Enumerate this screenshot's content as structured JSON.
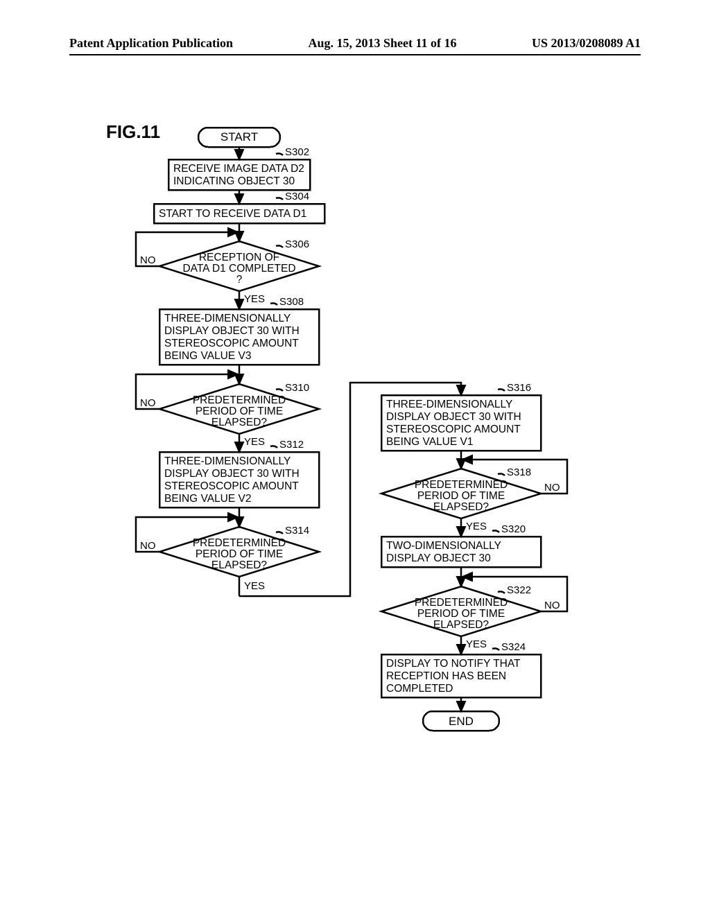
{
  "header": {
    "left": "Patent Application Publication",
    "mid": "Aug. 15, 2013  Sheet 11 of 16",
    "right": "US 2013/0208089 A1"
  },
  "fig_label": "FIG.11",
  "terminators": {
    "start": "START",
    "end": "END"
  },
  "steps": {
    "s302": {
      "ref": "S302",
      "l1": "RECEIVE IMAGE DATA D2",
      "l2": "INDICATING OBJECT 30"
    },
    "s304": {
      "ref": "S304",
      "l1": "START TO RECEIVE DATA D1"
    },
    "s306": {
      "ref": "S306",
      "l1": "RECEPTION OF",
      "l2": "DATA D1 COMPLETED",
      "l3": "?"
    },
    "s308": {
      "ref": "S308",
      "l1": "THREE-DIMENSIONALLY",
      "l2": "DISPLAY OBJECT 30 WITH",
      "l3": "STEREOSCOPIC AMOUNT",
      "l4": "BEING VALUE V3"
    },
    "s310": {
      "ref": "S310",
      "l1": "PREDETERMINED",
      "l2": "PERIOD OF TIME",
      "l3": "ELAPSED?"
    },
    "s312": {
      "ref": "S312",
      "l1": "THREE-DIMENSIONALLY",
      "l2": "DISPLAY OBJECT 30 WITH",
      "l3": "STEREOSCOPIC AMOUNT",
      "l4": "BEING VALUE V2"
    },
    "s314": {
      "ref": "S314",
      "l1": "PREDETERMINED",
      "l2": "PERIOD OF TIME",
      "l3": "ELAPSED?"
    },
    "s316": {
      "ref": "S316",
      "l1": "THREE-DIMENSIONALLY",
      "l2": "DISPLAY OBJECT 30 WITH",
      "l3": "STEREOSCOPIC AMOUNT",
      "l4": "BEING VALUE V1"
    },
    "s318": {
      "ref": "S318",
      "l1": "PREDETERMINED",
      "l2": "PERIOD OF TIME",
      "l3": "ELAPSED?"
    },
    "s320": {
      "ref": "S320",
      "l1": "TWO-DIMENSIONALLY",
      "l2": "DISPLAY OBJECT 30"
    },
    "s322": {
      "ref": "S322",
      "l1": "PREDETERMINED",
      "l2": "PERIOD OF TIME",
      "l3": "ELAPSED?"
    },
    "s324": {
      "ref": "S324",
      "l1": "DISPLAY TO NOTIFY THAT",
      "l2": "RECEPTION HAS BEEN",
      "l3": "COMPLETED"
    }
  },
  "branches": {
    "yes": "YES",
    "no": "NO"
  }
}
